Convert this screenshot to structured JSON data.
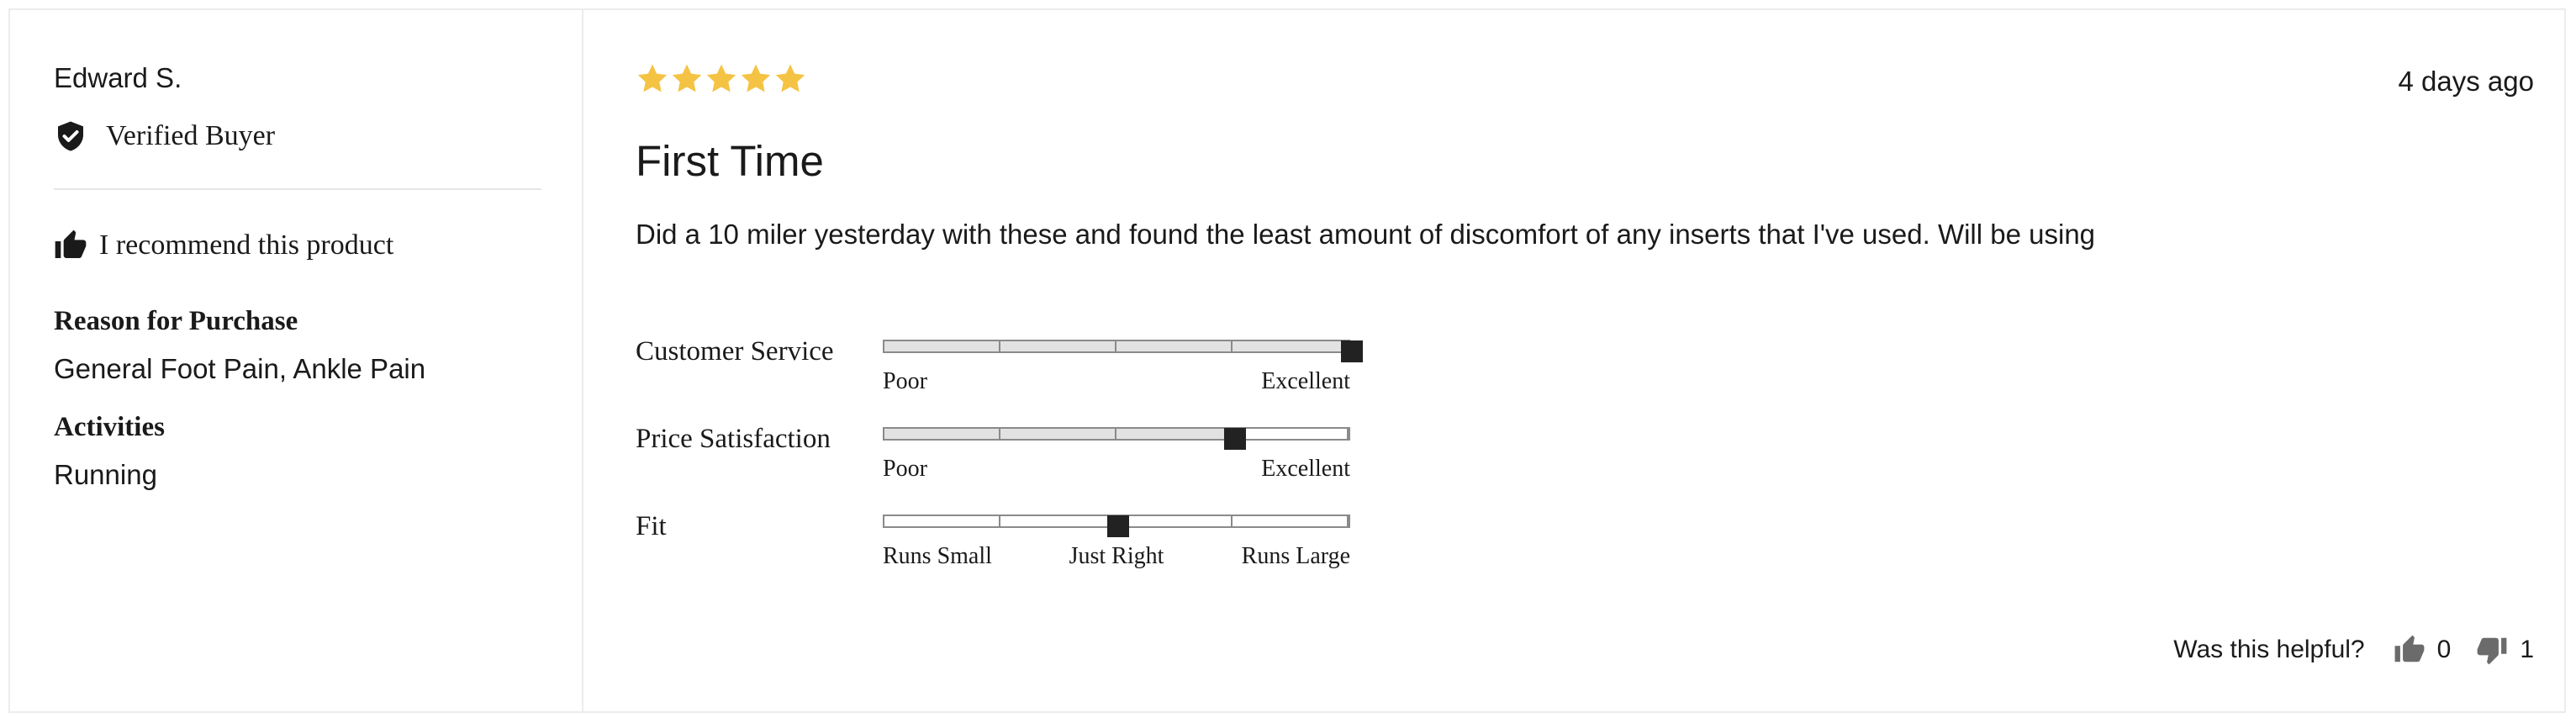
{
  "review": {
    "author": "Edward S.",
    "verified_label": "Verified Buyer",
    "recommend_label": "I recommend this product",
    "reason_heading": "Reason for Purchase",
    "reason_value": "General Foot Pain, Ankle Pain",
    "activities_heading": "Activities",
    "activities_value": "Running",
    "rating": 5,
    "max_rating": 5,
    "star_color": "#f5c344",
    "date": "4 days ago",
    "title": "First Time",
    "body": "Did a 10 miler yesterday with these and found the least amount of discomfort of any inserts that I've used. Will be using"
  },
  "ratings": [
    {
      "label": "Customer Service",
      "value": 1.0,
      "scale_labels": [
        "Poor",
        "Excellent"
      ],
      "filled": true
    },
    {
      "label": "Price Satisfaction",
      "value": 0.75,
      "scale_labels": [
        "Poor",
        "Excellent"
      ],
      "filled": true
    },
    {
      "label": "Fit",
      "value": 0.5,
      "scale_labels": [
        "Runs Small",
        "Just Right",
        "Runs Large"
      ],
      "filled": false
    }
  ],
  "helpful": {
    "question": "Was this helpful?",
    "up_count": "0",
    "down_count": "1",
    "icon_color": "#6b6b6b"
  }
}
